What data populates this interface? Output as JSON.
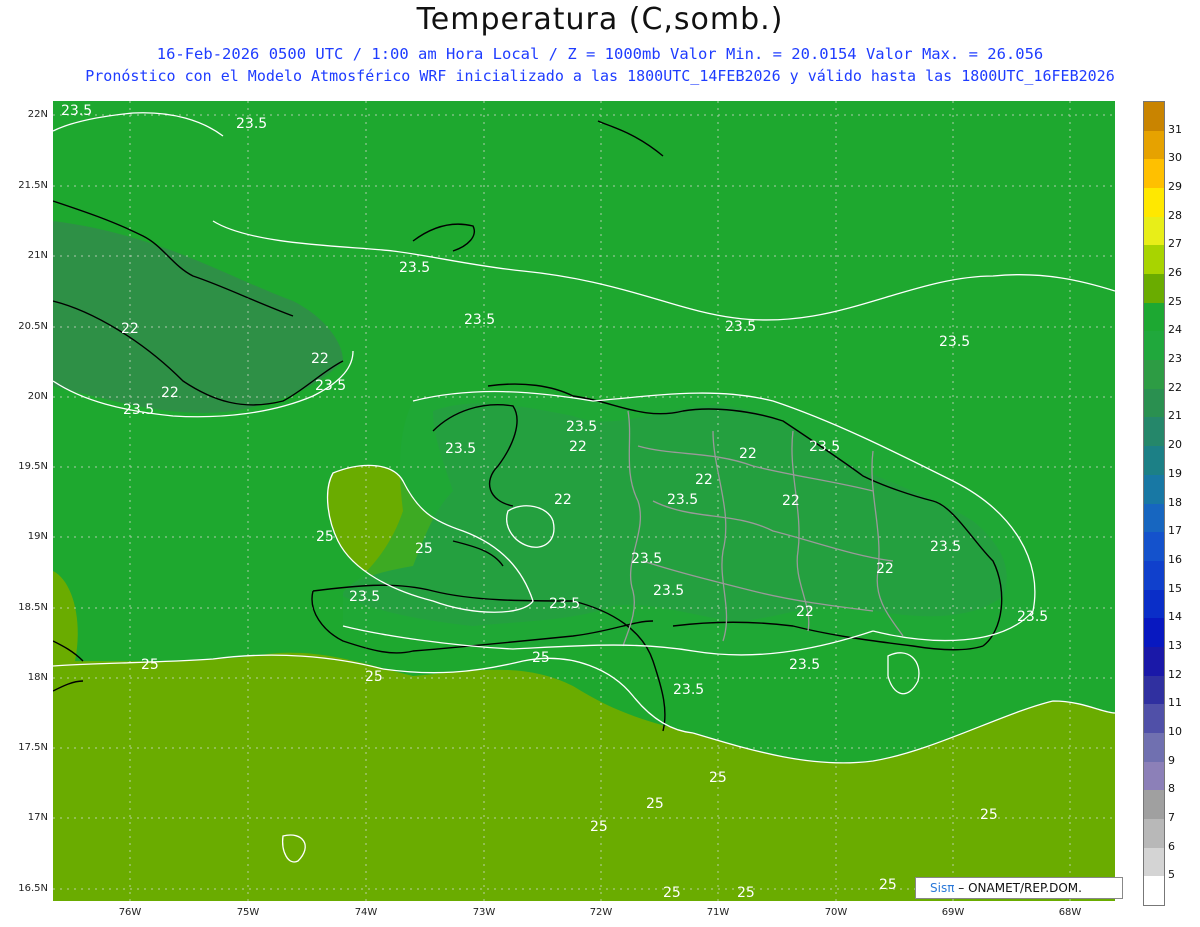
{
  "header": {
    "title": "Temperatura (C,somb.)",
    "line1": "16-Feb-2026  0500 UTC / 1:00 am Hora Local / Z = 1000mb    Valor Min. = 20.0154  Valor Max. = 26.056",
    "line2": "Pronóstico con el Modelo Atmosférico WRF inicializado a las 1800UTC_14FEB2026 y válido hasta las  1800UTC_16FEB2026"
  },
  "map": {
    "lat_labels": [
      "22N",
      "21.5N",
      "21N",
      "20.5N",
      "20N",
      "19.5N",
      "19N",
      "18.5N",
      "18N",
      "17.5N",
      "17N",
      "16.5N"
    ],
    "lon_labels": [
      "76W",
      "75W",
      "74W",
      "73W",
      "72W",
      "71W",
      "70W",
      "69W",
      "68W"
    ],
    "contour_labels": [
      "23.5",
      "22",
      "25"
    ],
    "fill_colors": {
      "t22": "#2e9448",
      "t23": "#20a83c",
      "t24": "#1da832",
      "t25": "#6aac00",
      "t26": "#88bb00"
    }
  },
  "colorbar": {
    "labels": [
      "31",
      "30",
      "29",
      "28",
      "27",
      "26",
      "25",
      "24",
      "23",
      "22",
      "21",
      "20",
      "19",
      "18",
      "17",
      "16",
      "15",
      "14",
      "13",
      "12",
      "11",
      "10",
      "9",
      "8",
      "7",
      "6",
      "5"
    ],
    "colors": [
      "#c98400",
      "#e6a200",
      "#ffc000",
      "#ffe800",
      "#e8ee18",
      "#a8d400",
      "#6aac00",
      "#1da832",
      "#20a83c",
      "#2d9c44",
      "#2a9050",
      "#25876a",
      "#1c8086",
      "#1878a4",
      "#1766c0",
      "#1452cc",
      "#1040cc",
      "#0a2ec8",
      "#0818c0",
      "#1a18a8",
      "#3030a0",
      "#5050a8",
      "#7070b0",
      "#8c80b8",
      "#a0a0a0",
      "#b8b8b8",
      "#d4d4d4",
      "#ffffff"
    ]
  },
  "credit": {
    "logo": "Sisπ",
    "org": "– ONAMET/REP.DOM."
  }
}
